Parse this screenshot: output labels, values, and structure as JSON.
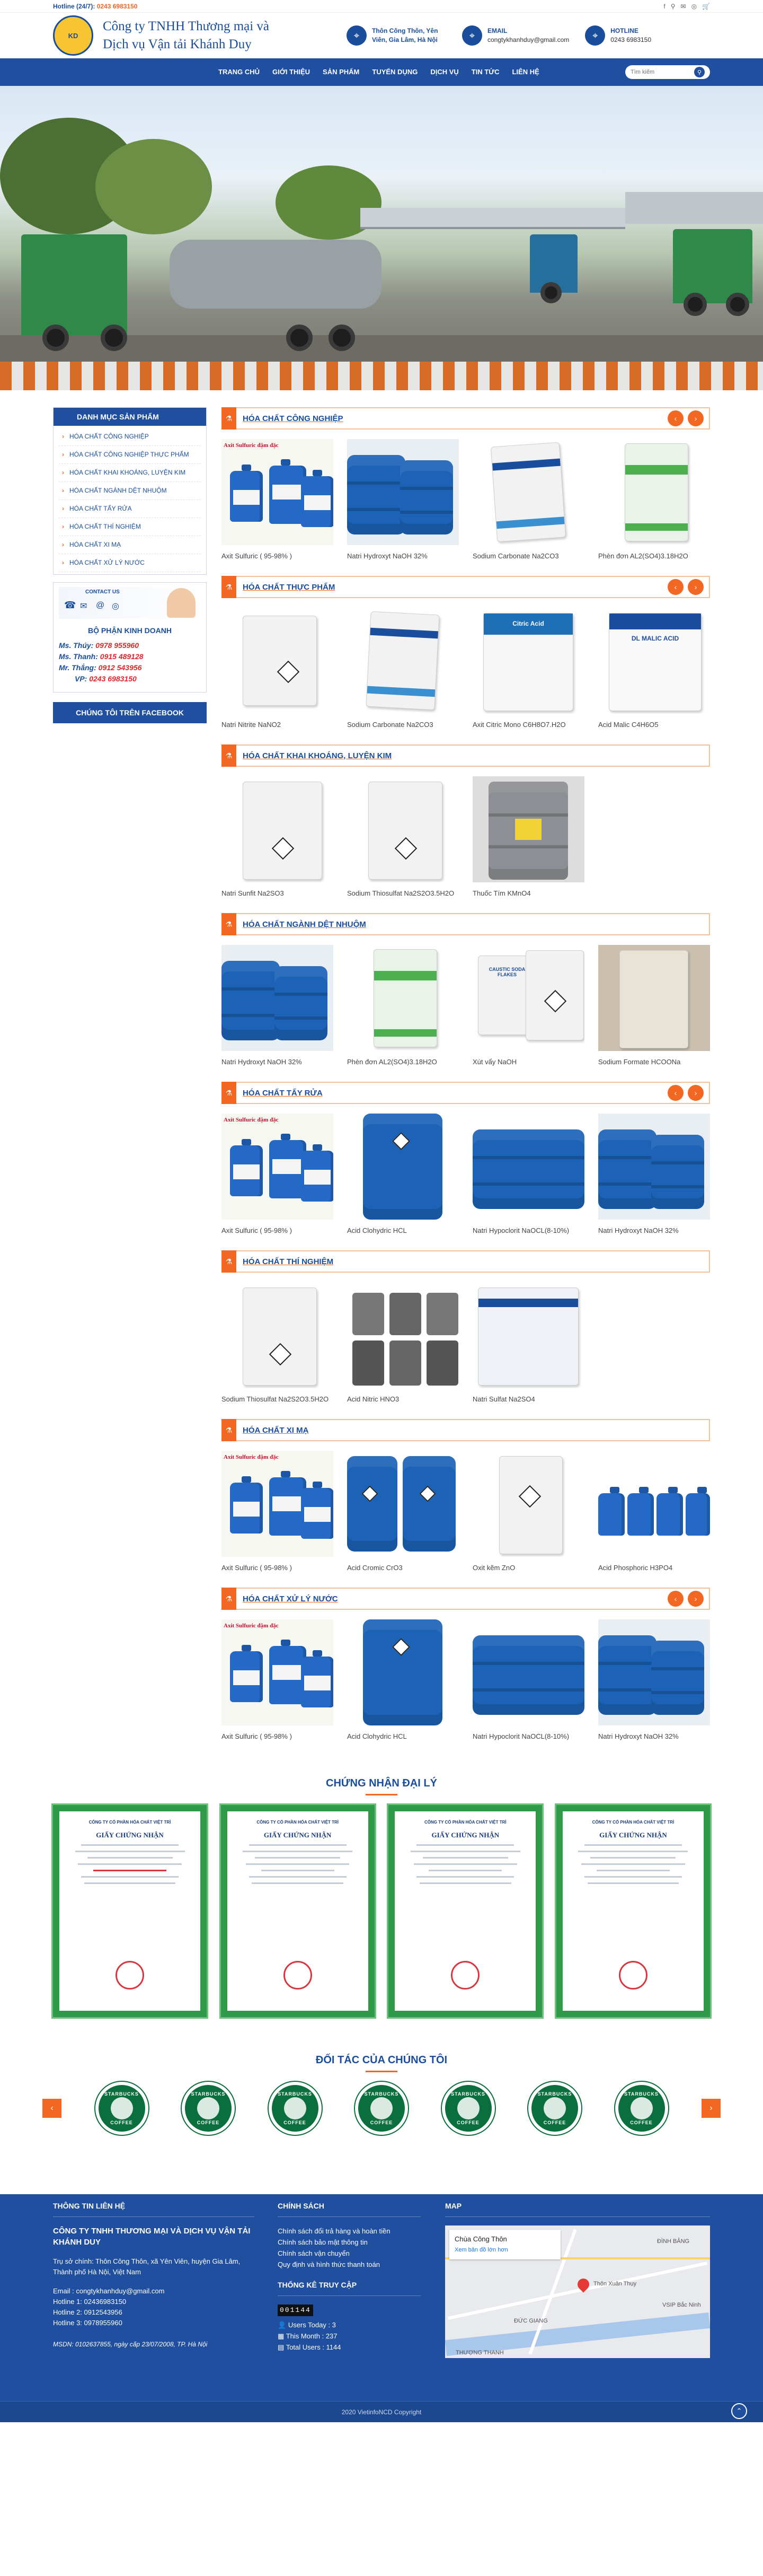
{
  "topbar": {
    "hotline_label": "Hotline (24/7):",
    "hotline_number": "0243 6983150",
    "social": [
      "f",
      "⚲",
      "✉",
      "◎",
      "🛒"
    ]
  },
  "header": {
    "logo_text": "KD",
    "brand_line1": "Công ty TNHH Thương mại và",
    "brand_line2": "Dịch vụ Vận tải Khánh Duy",
    "address": "Thôn Công Thôn, Yên Viên, Gia Lâm, Hà Nội",
    "email_label": "EMAIL",
    "email_value": "congtykhanhduy@gmail.com",
    "hotline_label": "HOTLINE",
    "hotline_value": "0243 6983150"
  },
  "nav": {
    "items": [
      "TRANG CHỦ",
      "GIỚI THIỆU",
      "SẢN PHẨM",
      "TUYỂN DỤNG",
      "DỊCH VỤ",
      "TIN TỨC",
      "LIÊN HỆ"
    ],
    "search_placeholder": "Tìm kiếm"
  },
  "sidebar": {
    "categories_title": "DANH MỤC SẢN PHẨM",
    "categories": [
      "HÓA CHẤT CÔNG NGHIỆP",
      "HÓA CHẤT CÔNG NGHIỆP THỰC PHẨM",
      "HÓA CHẤT KHAI KHOÁNG, LUYỆN KIM",
      "HÓA CHẤT NGÀNH DỆT NHUỘM",
      "HÓA CHẤT TẨY RỬA",
      "HÓA CHẤT THÍ NGHIỆM",
      "HÓA CHẤT XI MẠ",
      "HÓA CHẤT XỬ LÝ NƯỚC"
    ],
    "contact_banner": "CONTACT US",
    "sales_title": "BỘ PHẬN KINH DOANH",
    "sales": [
      {
        "name": "Ms. Thúy:",
        "phone": "0978 955960"
      },
      {
        "name": "Ms. Thanh:",
        "phone": "0915 489128"
      },
      {
        "name": "Mr. Thắng:",
        "phone": "0912 543956"
      },
      {
        "name": "VP:",
        "phone": "0243 6983150"
      }
    ],
    "facebook_button": "CHÚNG TÔI TRÊN FACEBOOK"
  },
  "sections": [
    {
      "title": "HÓA CHẤT CÔNG NGHIỆP",
      "arrows": true,
      "products": [
        "Axit Sulfuric ( 95-98% )",
        "Natri Hydroxyt NaOH 32%",
        "Sodium Carbonate Na2CO3",
        "Phèn đơn AL2(SO4)3.18H2O"
      ]
    },
    {
      "title": "HÓA CHẤT THỰC PHẨM",
      "arrows": true,
      "products": [
        "Natri Nitrite NaNO2",
        "Sodium Carbonate Na2CO3",
        "Axit Citric Mono C6H8O7.H2O",
        "Acid Malic C4H6O5"
      ]
    },
    {
      "title": "HÓA CHẤT KHAI KHOÁNG, LUYỆN KIM",
      "arrows": false,
      "products": [
        "Natri Sunfit Na2SO3",
        "Sodium Thiosulfat Na2S2O3.5H2O",
        "Thuốc Tím KMnO4"
      ]
    },
    {
      "title": "HÓA CHẤT NGÀNH DỆT NHUỘM",
      "arrows": false,
      "products": [
        "Natri Hydroxyt NaOH 32%",
        "Phèn đơn AL2(SO4)3.18H2O",
        "Xút vẩy NaOH",
        "Sodium Formate HCOONa"
      ]
    },
    {
      "title": "HÓA CHẤT TẨY RỬA",
      "arrows": true,
      "products": [
        "Axit Sulfuric ( 95-98% )",
        "Acid Clohydric HCL",
        "Natri Hypoclorit NaOCL(8-10%)",
        "Natri Hydroxyt NaOH 32%"
      ]
    },
    {
      "title": "HÓA CHẤT THÍ NGHIỆM",
      "arrows": false,
      "products": [
        "Sodium Thiosulfat Na2S2O3.5H2O",
        "Acid Nitric HNO3",
        "Natri Sulfat Na2SO4"
      ]
    },
    {
      "title": "HÓA CHẤT XI MẠ",
      "arrows": false,
      "products": [
        "Axit Sulfuric ( 95-98% )",
        "Acid Cromic CrO3",
        "Oxit kẽm ZnO",
        "Acid Phosphoric H3PO4"
      ]
    },
    {
      "title": "HÓA CHẤT XỬ LÝ NƯỚC",
      "arrows": true,
      "products": [
        "Axit Sulfuric ( 95-98% )",
        "Acid Clohydric HCL",
        "Natri Hypoclorit NaOCL(8-10%)",
        "Natri Hydroxyt NaOH 32%"
      ]
    }
  ],
  "product_art": {
    "sulfuric_label": "Axit Sulfuric đậm đặc",
    "citric_label": "Citric Acid",
    "malic_label": "DL MALIC ACID",
    "caustic_label": "CAUSTIC SODA FLAKES"
  },
  "certificates": {
    "title": "CHỨNG NHẬN ĐẠI LÝ",
    "cert_heading": "CÔNG TY CỔ PHẦN HÓA CHẤT VIỆT TRÌ",
    "cert_title": "GIẤY CHỨNG NHẬN",
    "count": 4
  },
  "partners": {
    "title": "ĐỐI TÁC CỦA CHÚNG TÔI",
    "logo_top": "STARBUCKS",
    "logo_bottom": "COFFEE",
    "count": 7
  },
  "footer": {
    "contact_title": "THÔNG TIN LIÊN HỆ",
    "company": "CÔNG TY TNHH THƯƠNG MẠI VÀ DỊCH VỤ VẬN TẢI KHÁNH DUY",
    "address_line1": "Trụ sở chính: Thôn Công Thôn, xã Yên Viên, huyện Gia Lâm,",
    "address_line2": "Thành phố Hà Nội, Việt Nam",
    "email": "Email : congtykhanhduy@gmail.com",
    "hotlines": [
      "Hotline 1: 02436983150",
      "Hotline 2: 0912543956",
      "Hotline 3: 0978955960"
    ],
    "msdn": "MSDN: 0102637855, ngày cấp 23/07/2008, TP. Hà Nội",
    "policy_title": "CHÍNH SÁCH",
    "policies": [
      "Chính sách đổi trả hàng và hoàn tiền",
      "Chính sách bảo mật thông tin",
      "Chính sách vận chuyển",
      "Quy định và hình thức thanh toán"
    ],
    "stats_title": "THỐNG KÊ TRUY CẬP",
    "counter": "001144",
    "stats": [
      "Users Today : 3",
      "This Month : 237",
      "Total Users : 1144"
    ],
    "map_title": "MAP",
    "map_place": "Chùa Công Thôn",
    "map_link": "Xem bản đồ lớn hơn",
    "map_labels": [
      "ĐÌNH BẢNG",
      "Thôn Xuân Thụy",
      "ĐỨC GIANG",
      "THƯỢNG THANH",
      "VSIP Bắc Ninh"
    ],
    "copyright": "2020 VietinfoNCD Copyright"
  }
}
